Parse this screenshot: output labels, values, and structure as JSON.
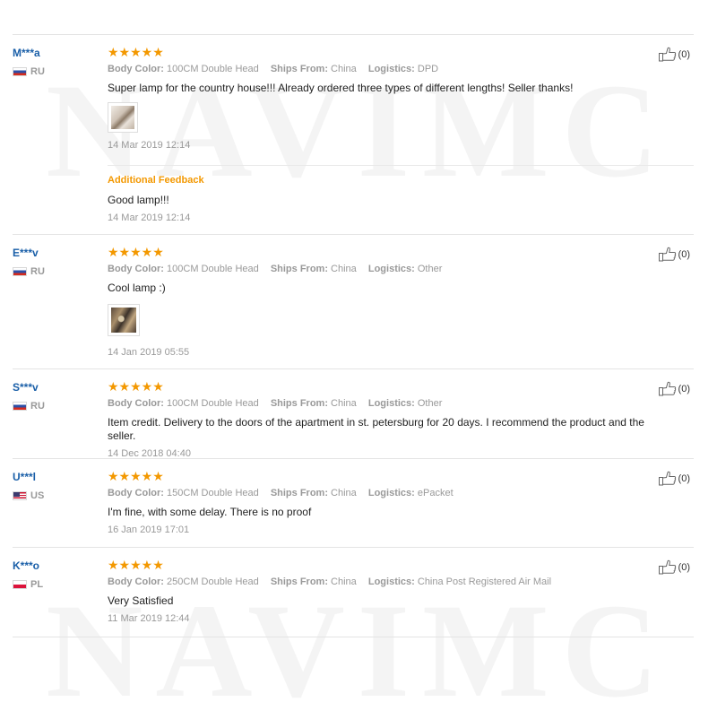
{
  "watermark": "NAVIMC",
  "labels": {
    "body_color": "Body Color:",
    "ships_from": "Ships From:",
    "logistics": "Logistics:"
  },
  "stars": "★★★★★",
  "reviews": [
    {
      "user": "M***a",
      "country": "RU",
      "flag": "ru",
      "body_color": "100CM Double Head",
      "ships_from": "China",
      "logistics": "DPD",
      "text": "Super lamp for the country house!!! Already ordered three types of different lengths! Seller thanks!",
      "has_photo": true,
      "date": "14 Mar 2019 12:14",
      "likes": "(0)",
      "additional_feedback": {
        "title": "Additional Feedback",
        "text": "Good lamp!!!",
        "date": "14 Mar 2019 12:14"
      }
    },
    {
      "user": "E***v",
      "country": "RU",
      "flag": "ru",
      "body_color": "100CM Double Head",
      "ships_from": "China",
      "logistics": "Other",
      "text": "Cool lamp :)",
      "has_photo": true,
      "date": "14 Jan 2019 05:55",
      "likes": "(0)"
    },
    {
      "user": "S***v",
      "country": "RU",
      "flag": "ru",
      "body_color": "100CM Double Head",
      "ships_from": "China",
      "logistics": "Other",
      "text": "Item credit. Delivery to the doors of the apartment in st. petersburg for 20 days. I recommend the product and the seller.",
      "has_photo": false,
      "date": "14 Dec 2018 04:40",
      "likes": "(0)"
    },
    {
      "user": "U***l",
      "country": "US",
      "flag": "us",
      "body_color": "150CM Double Head",
      "ships_from": "China",
      "logistics": "ePacket",
      "text": "I'm fine, with some delay. There is no proof",
      "has_photo": false,
      "date": "16 Jan 2019 17:01",
      "likes": "(0)"
    },
    {
      "user": "K***o",
      "country": "PL",
      "flag": "pl",
      "body_color": "250CM Double Head",
      "ships_from": "China",
      "logistics": "China Post Registered Air Mail",
      "text": "Very Satisfied",
      "has_photo": false,
      "date": "11 Mar 2019 12:44",
      "likes": "(0)"
    }
  ],
  "colors": {
    "user_name": "#1a5fa8",
    "stars": "#f39800",
    "additional_feedback_title": "#f39800",
    "meta_text": "#999999"
  },
  "icons": {
    "like": "thumbs-up-icon"
  }
}
